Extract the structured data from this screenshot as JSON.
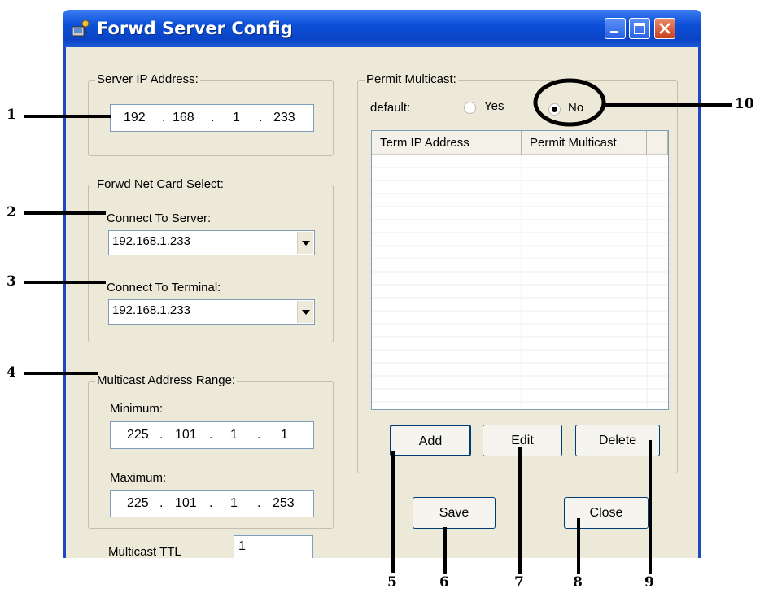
{
  "window": {
    "title": "Forwd Server Config"
  },
  "server_ip": {
    "legend": "Server IP Address:",
    "octets": [
      "192",
      "168",
      "1",
      "233"
    ]
  },
  "net_card": {
    "legend": "Forwd Net Card Select:",
    "server_label": "Connect To Server:",
    "server_value": "192.168.1.233",
    "terminal_label": "Connect To Terminal:",
    "terminal_value": "192.168.1.233"
  },
  "multicast_range": {
    "legend": "Multicast Address Range:",
    "min_label": "Minimum:",
    "min_octets": [
      "225",
      "101",
      "1",
      "1"
    ],
    "max_label": "Maximum:",
    "max_octets": [
      "225",
      "101",
      "1",
      "253"
    ]
  },
  "ttl": {
    "label": "Multicast TTL",
    "value": "1"
  },
  "permit": {
    "legend": "Permit Multicast:",
    "default_label": "default:",
    "yes_label": "Yes",
    "no_label": "No",
    "selected": "No",
    "columns": [
      "Term IP Address",
      "Permit Multicast"
    ]
  },
  "buttons": {
    "add": "Add",
    "edit": "Edit",
    "delete": "Delete",
    "save": "Save",
    "close": "Close"
  },
  "callouts": [
    "1",
    "2",
    "3",
    "4",
    "5",
    "6",
    "7",
    "8",
    "9",
    "10"
  ],
  "colors": {
    "titlebar": "#0a44c6",
    "client_bg": "#ece9d8",
    "close_button": "#c8401d"
  }
}
